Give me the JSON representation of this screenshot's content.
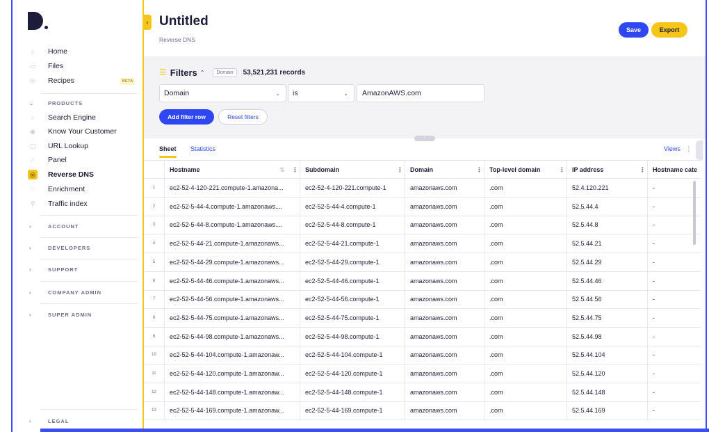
{
  "sidebar": {
    "items": [
      {
        "label": "Home",
        "icon": "home-icon",
        "glyph": "⌂"
      },
      {
        "label": "Files",
        "icon": "folder-icon",
        "glyph": "▭"
      },
      {
        "label": "Recipes",
        "icon": "recipe-icon",
        "glyph": "◎"
      }
    ],
    "beta_label": "BETA",
    "products_label": "PRODUCTS",
    "products": [
      {
        "label": "Search Engine",
        "icon": "search-icon",
        "glyph": "○"
      },
      {
        "label": "Know Your Customer",
        "icon": "eye-icon",
        "glyph": "◉"
      },
      {
        "label": "URL Lookup",
        "icon": "link-icon",
        "glyph": "▢"
      },
      {
        "label": "Panel",
        "icon": "chart-icon",
        "glyph": "⟋"
      },
      {
        "label": "Reverse DNS",
        "icon": "dns-icon",
        "glyph": "◎",
        "active": true
      },
      {
        "label": "Enrichment",
        "icon": "enrichment-icon",
        "glyph": "♡"
      },
      {
        "label": "Traffic index",
        "icon": "traffic-icon",
        "glyph": "⚲"
      }
    ],
    "sections": [
      "ACCOUNT",
      "DEVELOPERS",
      "SUPPORT",
      "COMPANY ADMIN",
      "SUPER ADMIN"
    ],
    "legal_label": "LEGAL"
  },
  "header": {
    "title": "Untitled",
    "subtitle": "Reverse DNS",
    "save_label": "Save",
    "export_label": "Export"
  },
  "filters": {
    "label": "Filters",
    "chip": "Domain",
    "records": "53,521,231 records",
    "field": "Domain",
    "operator": "is",
    "value": "AmazonAWS.com",
    "add_label": "Add filter row",
    "reset_label": "Reset filters"
  },
  "tabs": {
    "sheet": "Sheet",
    "statistics": "Statistics",
    "views": "Views"
  },
  "table": {
    "columns": [
      "Hostname",
      "Subdomain",
      "Domain",
      "Top-level domain",
      "IP address",
      "Hostname cate"
    ],
    "rows": [
      [
        "1",
        "ec2-52-4-120-221.compute-1.amazona...",
        "ec2-52-4-120-221.compute-1",
        "amazonaws.com",
        ".com",
        "52.4.120.221",
        "-"
      ],
      [
        "2",
        "ec2-52-5-44-4.compute-1.amazonaws....",
        "ec2-52-5-44-4.compute-1",
        "amazonaws.com",
        ".com",
        "52.5.44.4",
        "-"
      ],
      [
        "3",
        "ec2-52-5-44-8.compute-1.amazonaws....",
        "ec2-52-5-44-8.compute-1",
        "amazonaws.com",
        ".com",
        "52.5.44.8",
        "-"
      ],
      [
        "4",
        "ec2-52-5-44-21.compute-1.amazonaws...",
        "ec2-52-5-44-21.compute-1",
        "amazonaws.com",
        ".com",
        "52.5.44.21",
        "-"
      ],
      [
        "5",
        "ec2-52-5-44-29.compute-1.amazonaws...",
        "ec2-52-5-44-29.compute-1",
        "amazonaws.com",
        ".com",
        "52.5.44.29",
        "-"
      ],
      [
        "6",
        "ec2-52-5-44-46.compute-1.amazonaws...",
        "ec2-52-5-44-46.compute-1",
        "amazonaws.com",
        ".com",
        "52.5.44.46",
        "-"
      ],
      [
        "7",
        "ec2-52-5-44-56.compute-1.amazonaws...",
        "ec2-52-5-44-56.compute-1",
        "amazonaws.com",
        ".com",
        "52.5.44.56",
        "-"
      ],
      [
        "8",
        "ec2-52-5-44-75.compute-1.amazonaws...",
        "ec2-52-5-44-75.compute-1",
        "amazonaws.com",
        ".com",
        "52.5.44.75",
        "-"
      ],
      [
        "9",
        "ec2-52-5-44-98.compute-1.amazonaws...",
        "ec2-52-5-44-98.compute-1",
        "amazonaws.com",
        ".com",
        "52.5.44.98",
        "-"
      ],
      [
        "10",
        "ec2-52-5-44-104.compute-1.amazonaw...",
        "ec2-52-5-44-104.compute-1",
        "amazonaws.com",
        ".com",
        "52.5.44.104",
        "-"
      ],
      [
        "11",
        "ec2-52-5-44-120.compute-1.amazonaw...",
        "ec2-52-5-44-120.compute-1",
        "amazonaws.com",
        ".com",
        "52.5.44.120",
        "-"
      ],
      [
        "12",
        "ec2-52-5-44-148.compute-1.amazonaw...",
        "ec2-52-5-44-148.compute-1",
        "amazonaws.com",
        ".com",
        "52.5.44.148",
        "-"
      ],
      [
        "13",
        "ec2-52-5-44-169.compute-1.amazonaw...",
        "ec2-52-5-44-169.compute-1",
        "amazonaws.com",
        ".com",
        "52.5.44.169",
        "-"
      ]
    ]
  },
  "colors": {
    "accent_blue": "#2f47f2",
    "accent_yellow": "#f5c518",
    "frame_blue": "#3b4ef5"
  }
}
